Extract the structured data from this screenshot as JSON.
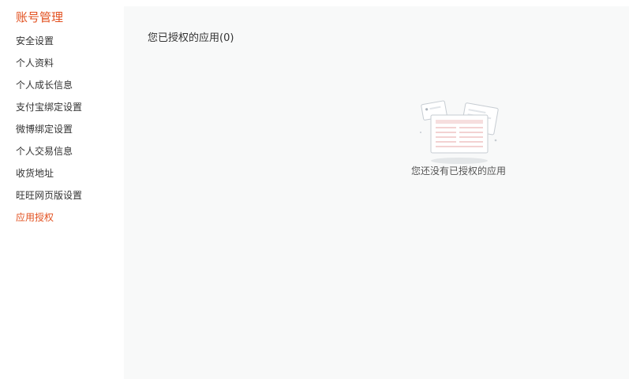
{
  "sidebar": {
    "title": "账号管理",
    "items": [
      {
        "label": "安全设置",
        "active": false
      },
      {
        "label": "个人资料",
        "active": false
      },
      {
        "label": "个人成长信息",
        "active": false
      },
      {
        "label": "支付宝绑定设置",
        "active": false
      },
      {
        "label": "微博绑定设置",
        "active": false
      },
      {
        "label": "个人交易信息",
        "active": false
      },
      {
        "label": "收货地址",
        "active": false
      },
      {
        "label": "旺旺网页版设置",
        "active": false
      },
      {
        "label": "应用授权",
        "active": true
      }
    ]
  },
  "main": {
    "title": "您已授权的应用(0)",
    "empty_text": "您还没有已授权的应用"
  },
  "colors": {
    "accent": "#e2501f",
    "text": "#333333",
    "panel_bg": "#f8f9f9"
  },
  "icons": {
    "empty_state": "empty-documents-illustration"
  }
}
